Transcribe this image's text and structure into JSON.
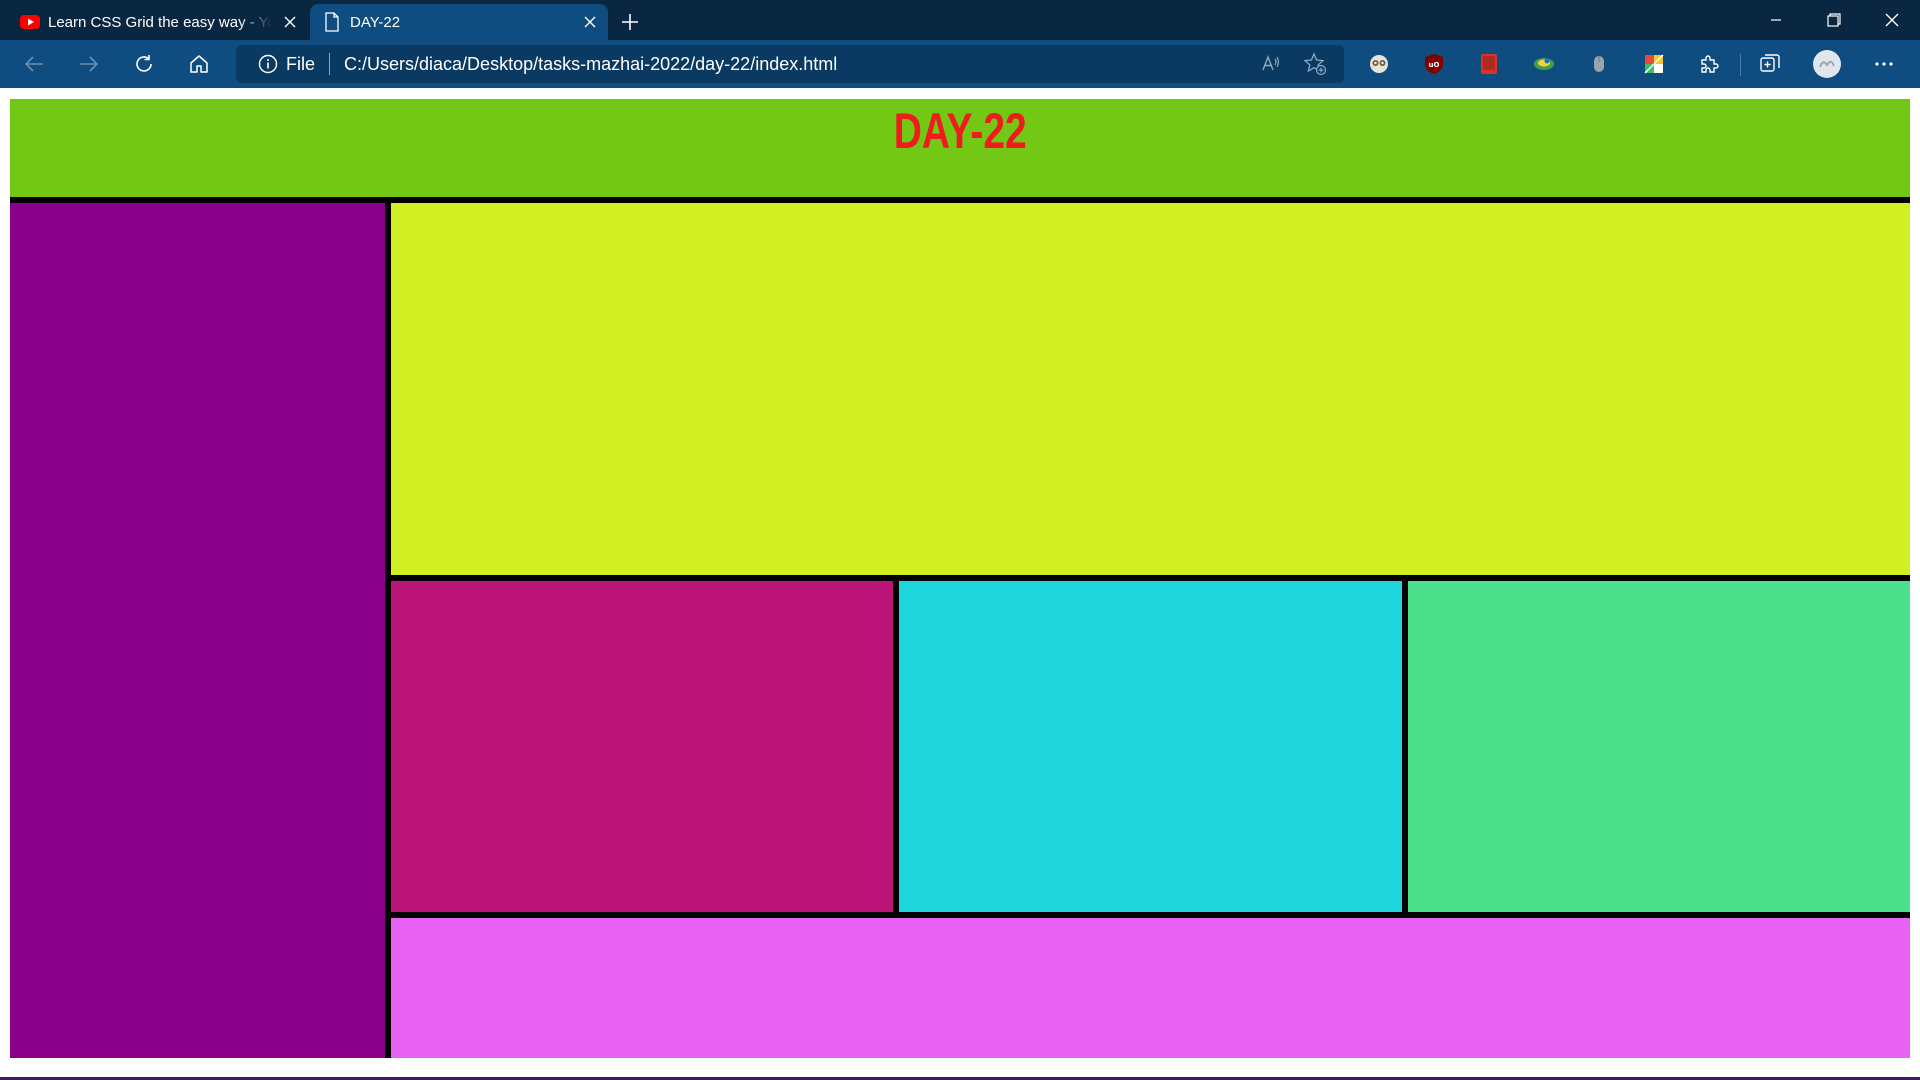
{
  "browser": {
    "tabs": [
      {
        "title": "Learn CSS Grid the easy way - Yo",
        "icon": "youtube-icon",
        "active": false
      },
      {
        "title": "DAY-22",
        "icon": "file-icon",
        "active": true
      }
    ],
    "address": {
      "scheme_label": "File",
      "url": "C:/Users/diaca/Desktop/tasks-mazhai-2022/day-22/index.html"
    }
  },
  "page": {
    "heading": "DAY-22"
  },
  "colors": {
    "titlebar": "#0a2742",
    "toolbar": "#0f4c7f",
    "header": "#72c815",
    "heading_text": "#ee1c1c",
    "sidebar": "#8b0089",
    "main": "#d1f024",
    "box1": "#bb1577",
    "box2": "#1fd5dc",
    "box3": "#4be08b",
    "footer": "#e863f3",
    "grid_gap": "#000000"
  },
  "icons": [
    "back-arrow-icon",
    "forward-arrow-icon",
    "reload-icon",
    "home-icon",
    "info-icon",
    "read-aloud-icon",
    "add-favorite-icon",
    "extension-icon",
    "collections-icon",
    "profile-avatar-icon",
    "more-menu-icon"
  ]
}
